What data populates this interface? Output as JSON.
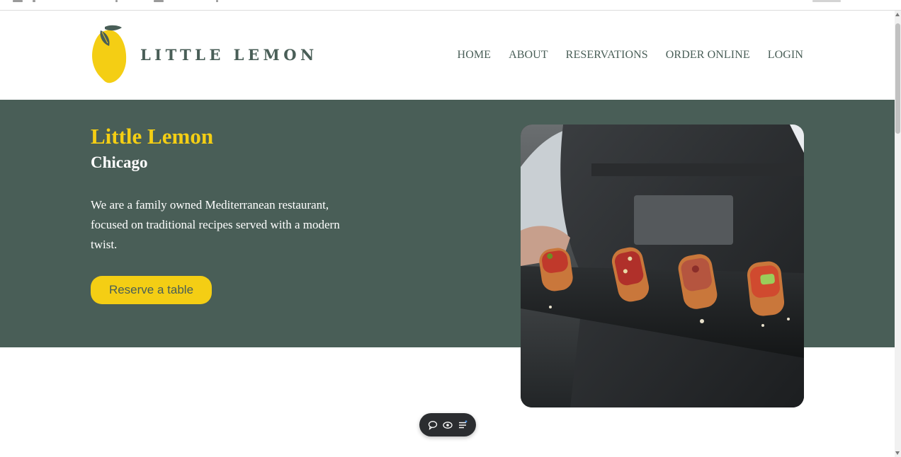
{
  "brand": {
    "name": "LITTLE LEMON",
    "primary_color": "#495e57",
    "accent_color": "#f4ce14"
  },
  "nav": {
    "items": [
      {
        "label": "HOME"
      },
      {
        "label": "ABOUT"
      },
      {
        "label": "RESERVATIONS"
      },
      {
        "label": "ORDER ONLINE"
      },
      {
        "label": "LOGIN"
      }
    ]
  },
  "hero": {
    "title": "Little Lemon",
    "subtitle": "Chicago",
    "description": "We are a family owned Mediterranean restaurant, focused on traditional recipes served with a modern twist.",
    "cta_label": "Reserve a table"
  },
  "toolbar": {
    "icons": [
      "chat-bubble-icon",
      "eye-icon",
      "list-icon"
    ]
  }
}
